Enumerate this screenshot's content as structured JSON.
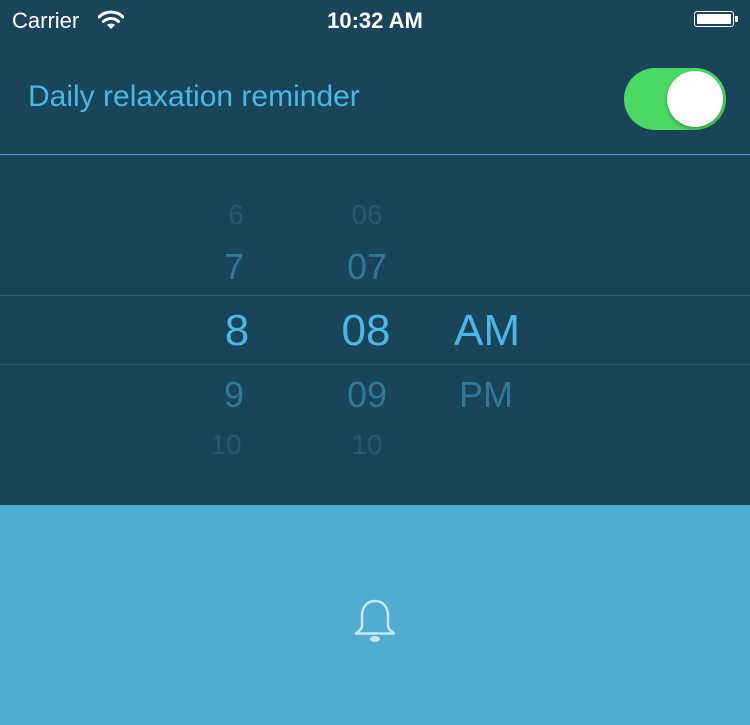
{
  "status_bar": {
    "carrier": "Carrier",
    "time": "10:32 AM",
    "wifi_icon": "wifi-icon",
    "battery_icon": "battery-icon"
  },
  "reminder": {
    "label": "Daily relaxation reminder",
    "enabled": true,
    "toggle_on_color": "#4bd964"
  },
  "picker": {
    "hours": [
      "6",
      "7",
      "8",
      "9",
      "10"
    ],
    "minutes": [
      "06",
      "07",
      "08",
      "09",
      "10"
    ],
    "periods": [
      "AM",
      "PM"
    ],
    "selected_hour": "8",
    "selected_minute": "08",
    "selected_period": "AM"
  },
  "colors": {
    "background": "#1a4459",
    "accent": "#47b8ea",
    "bottom_panel": "#51adcf"
  },
  "bottom_panel": {
    "icon": "bell-icon"
  }
}
